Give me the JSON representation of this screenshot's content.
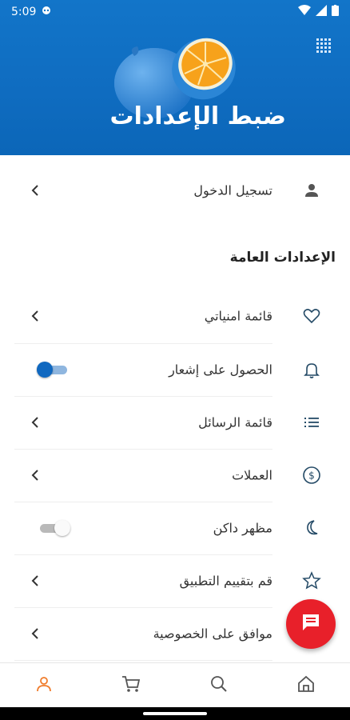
{
  "status_bar": {
    "time": "5:09"
  },
  "header": {
    "title": "ضبط الإعدادات",
    "menu_icon": "grid-icon"
  },
  "login": {
    "label": "تسجيل الدخول",
    "icon": "person-icon"
  },
  "general_section": {
    "title": "الإعدادات العامة"
  },
  "settings": {
    "wishlist": {
      "label": "قائمة امنياتي",
      "icon": "heart-icon"
    },
    "notifications": {
      "label": "الحصول على إشعار",
      "icon": "bell-icon",
      "enabled": true
    },
    "messages": {
      "label": "قائمة الرسائل",
      "icon": "list-icon"
    },
    "currencies": {
      "label": "العملات",
      "icon": "dollar-icon"
    },
    "dark_mode": {
      "label": "مظهر داكن",
      "icon": "moon-icon",
      "enabled": false
    },
    "rate_app": {
      "label": "قم بتقييم التطبيق",
      "icon": "star-icon"
    },
    "privacy": {
      "label": "موافق على الخصوصية",
      "icon": "shield-icon"
    }
  },
  "bottom_nav": [
    "person-icon",
    "cart-icon",
    "search-icon",
    "home-icon"
  ],
  "colors": {
    "primary": "#1068c0",
    "accent_active": "#f07b2a",
    "fab": "#e8202a",
    "toggle_on": "#1068c0"
  }
}
